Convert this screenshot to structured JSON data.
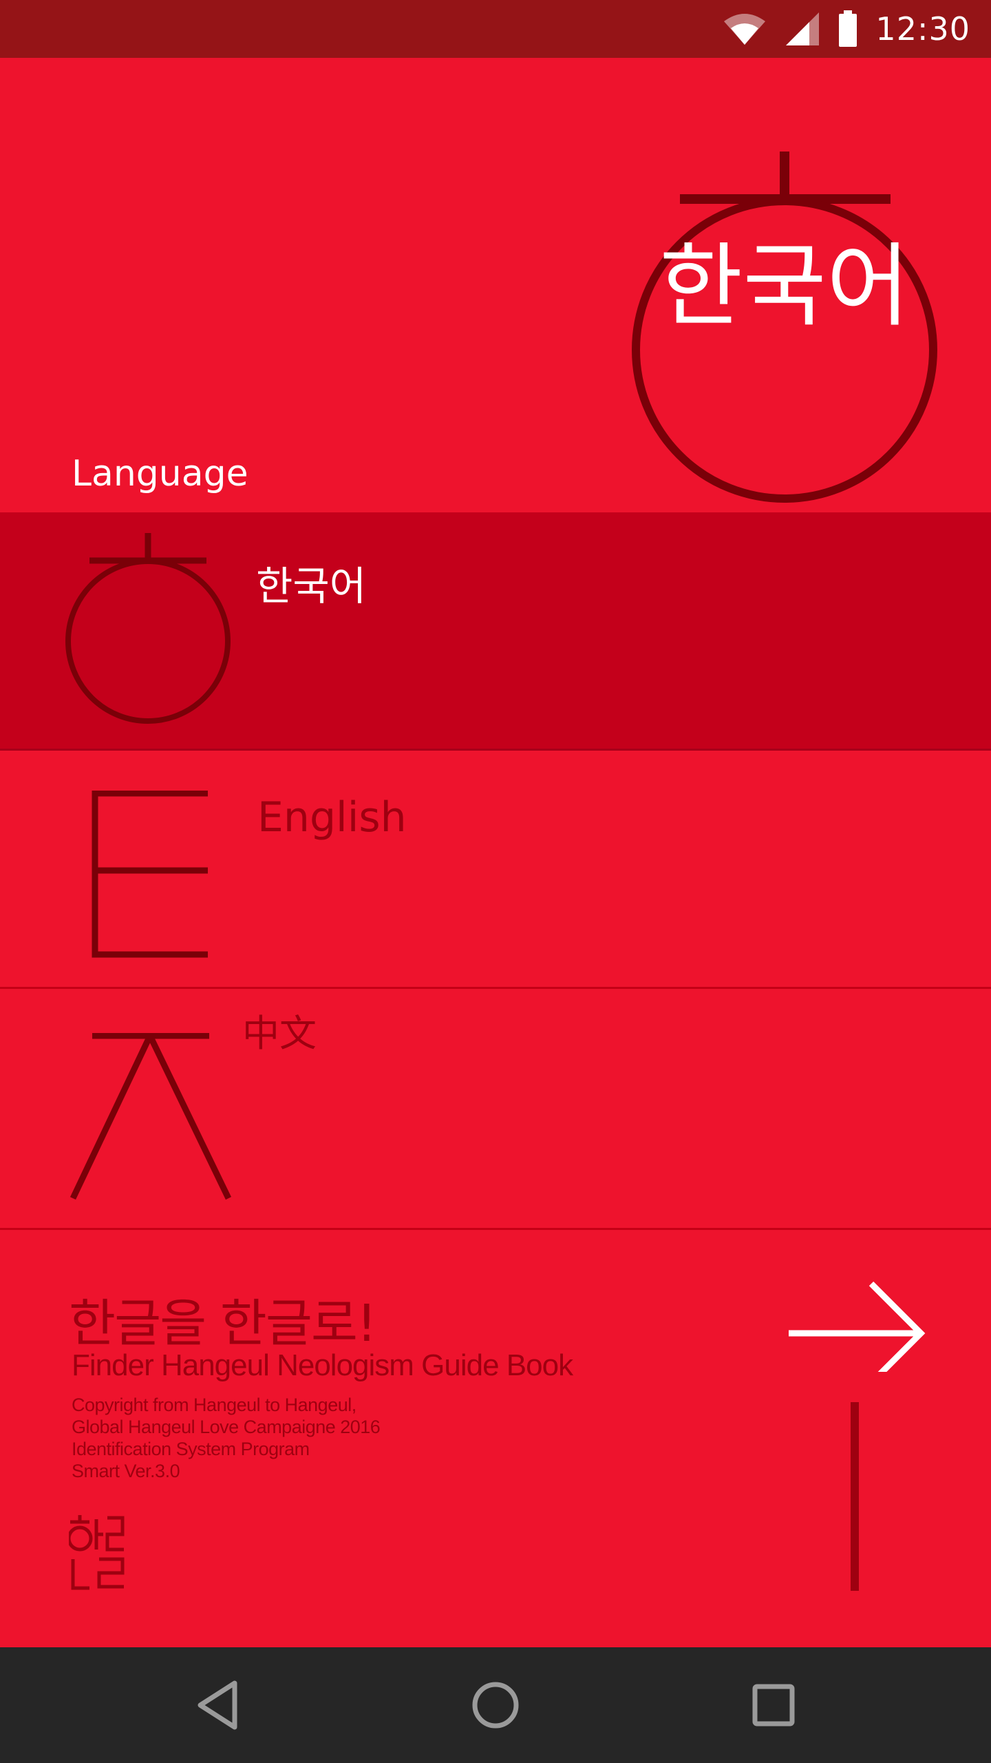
{
  "status_bar": {
    "time": "12:30",
    "icons": [
      "wifi-icon",
      "cellular-signal-icon",
      "battery-icon"
    ]
  },
  "hero": {
    "current_language": "한국어"
  },
  "language_heading": "Language",
  "languages": [
    {
      "label": "한국어",
      "glyph": "korean-hieut-glyph-icon",
      "selected": true
    },
    {
      "label": "English",
      "glyph": "english-e-glyph-icon",
      "selected": false
    },
    {
      "label": "中文",
      "glyph": "chinese-jieut-glyph-icon",
      "selected": false
    }
  ],
  "footer": {
    "slogan": "한글을 한글로!",
    "subtitle": "Finder Hangeul Neologism Guide Book",
    "copyright_lines": [
      "Copyright from Hangeul to Hangeul,",
      "Global Hangeul Love Campaigne 2016",
      "Identification System Program",
      "Smart Ver.3.0"
    ],
    "logo": "hangeul-logo-icon",
    "next_icon": "arrow-right-icon"
  },
  "nav_bar": {
    "buttons": [
      "back-icon",
      "home-icon",
      "recents-icon"
    ]
  },
  "colors": {
    "background": "#EE132D",
    "status_bar": "#951417",
    "selected_row": "#C4001B",
    "dark_red": "#9E0010",
    "glyph_stroke": "#7A0008",
    "nav_bar": "#262626",
    "white": "#FFFFFF"
  }
}
